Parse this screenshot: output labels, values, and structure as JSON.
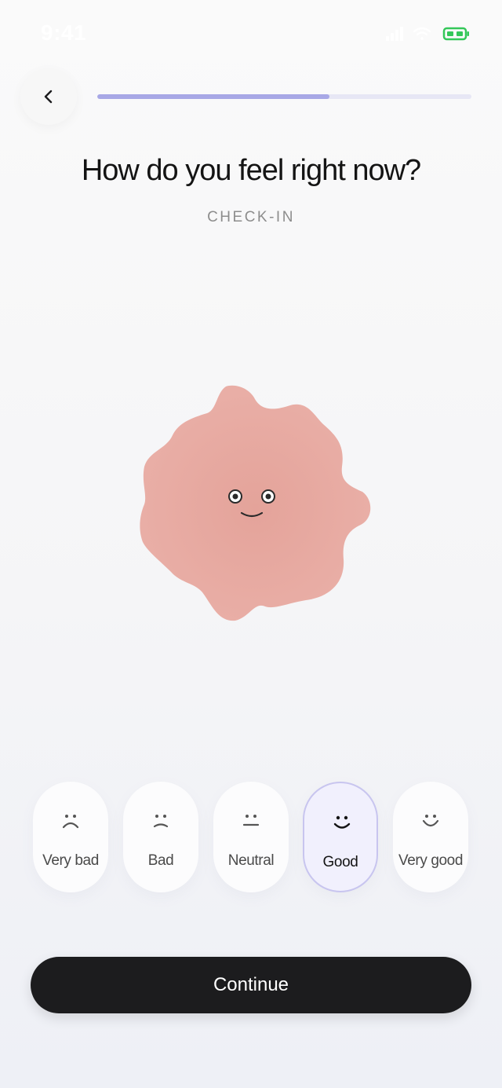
{
  "status_bar": {
    "time": "9:41",
    "icons": [
      "signal-icon",
      "wifi-icon",
      "battery-icon"
    ],
    "battery_color": "#34c759"
  },
  "header": {
    "back_icon": "chevron-left-icon",
    "progress_fraction": 0.62,
    "progress_color": "#a8a8e6",
    "track_color": "#e7e7f5"
  },
  "title": "How do you feel right now?",
  "subtitle": "CHECK-IN",
  "character": {
    "icon": "mood-blob-character",
    "color": "#e8ada5"
  },
  "moods": [
    {
      "label": "Very bad",
      "icon": "very-bad-face-icon",
      "selected": false
    },
    {
      "label": "Bad",
      "icon": "bad-face-icon",
      "selected": false
    },
    {
      "label": "Neutral",
      "icon": "neutral-face-icon",
      "selected": false
    },
    {
      "label": "Good",
      "icon": "good-face-icon",
      "selected": true
    },
    {
      "label": "Very good",
      "icon": "very-good-face-icon",
      "selected": false
    }
  ],
  "selected_accent": "#c8c5ef",
  "continue_label": "Continue"
}
